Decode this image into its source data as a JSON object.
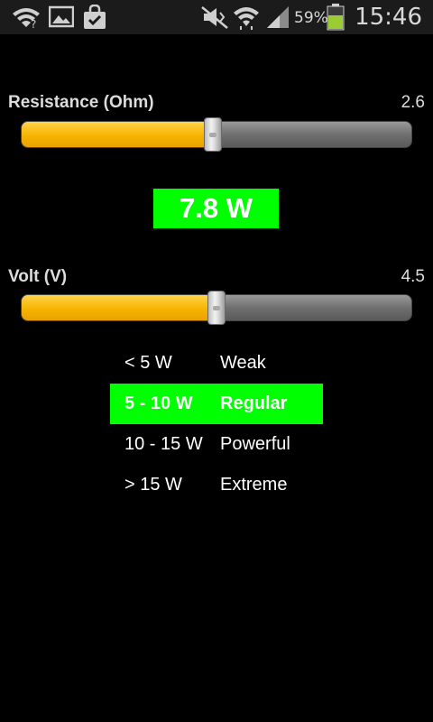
{
  "status_bar": {
    "time": "15:46",
    "battery_percent": "59%",
    "icons": [
      "wifi-notification-icon",
      "gallery-icon",
      "shopping-bag-icon",
      "mute-icon",
      "wifi-icon",
      "signal-icon",
      "battery-icon"
    ]
  },
  "resistance": {
    "label": "Resistance (Ohm)",
    "value": "2.6",
    "fraction": 0.49
  },
  "power": {
    "value": "7.8 W"
  },
  "volt": {
    "label": "Volt (V)",
    "value": "4.5",
    "fraction": 0.5
  },
  "ranges": [
    {
      "range": "< 5 W",
      "label": "Weak"
    },
    {
      "range": "5 - 10 W",
      "label": "Regular"
    },
    {
      "range": "10 - 15 W",
      "label": "Powerful"
    },
    {
      "range": "> 15 W",
      "label": "Extreme"
    }
  ],
  "colors": {
    "accent_green": "#00ff00",
    "slider_fill": "#f7b400",
    "background": "#000000"
  }
}
